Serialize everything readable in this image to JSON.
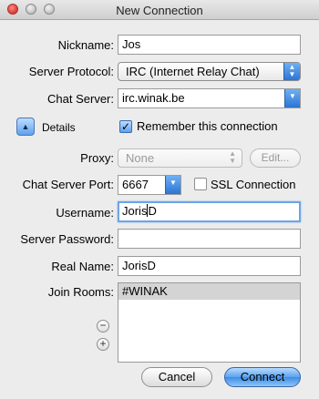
{
  "window": {
    "title": "New Connection"
  },
  "form": {
    "nickname_label": "Nickname:",
    "nickname_value": "Jos",
    "protocol_label": "Server Protocol:",
    "protocol_value": "IRC (Internet Relay Chat)",
    "server_label": "Chat Server:",
    "server_value": "irc.winak.be",
    "details_label": "Details",
    "remember_label": "Remember this connection",
    "remember_checked": true,
    "proxy_label": "Proxy:",
    "proxy_value": "None",
    "proxy_edit": "Edit...",
    "port_label": "Chat Server Port:",
    "port_value": "6667",
    "ssl_label": "SSL Connection",
    "ssl_checked": false,
    "username_label": "Username:",
    "username_value_before_caret": "Joris",
    "username_value_after_caret": "D",
    "password_label": "Server Password:",
    "password_value": "",
    "realname_label": "Real Name:",
    "realname_value": "JorisD",
    "rooms_label": "Join Rooms:",
    "rooms": [
      "#WINAK"
    ]
  },
  "icons": {
    "remove": "−",
    "add": "+",
    "disclosure": "▲",
    "popup_up": "▲",
    "popup_down": "▼",
    "combo_down": "▼",
    "check": "✓"
  },
  "buttons": {
    "cancel": "Cancel",
    "connect": "Connect"
  }
}
